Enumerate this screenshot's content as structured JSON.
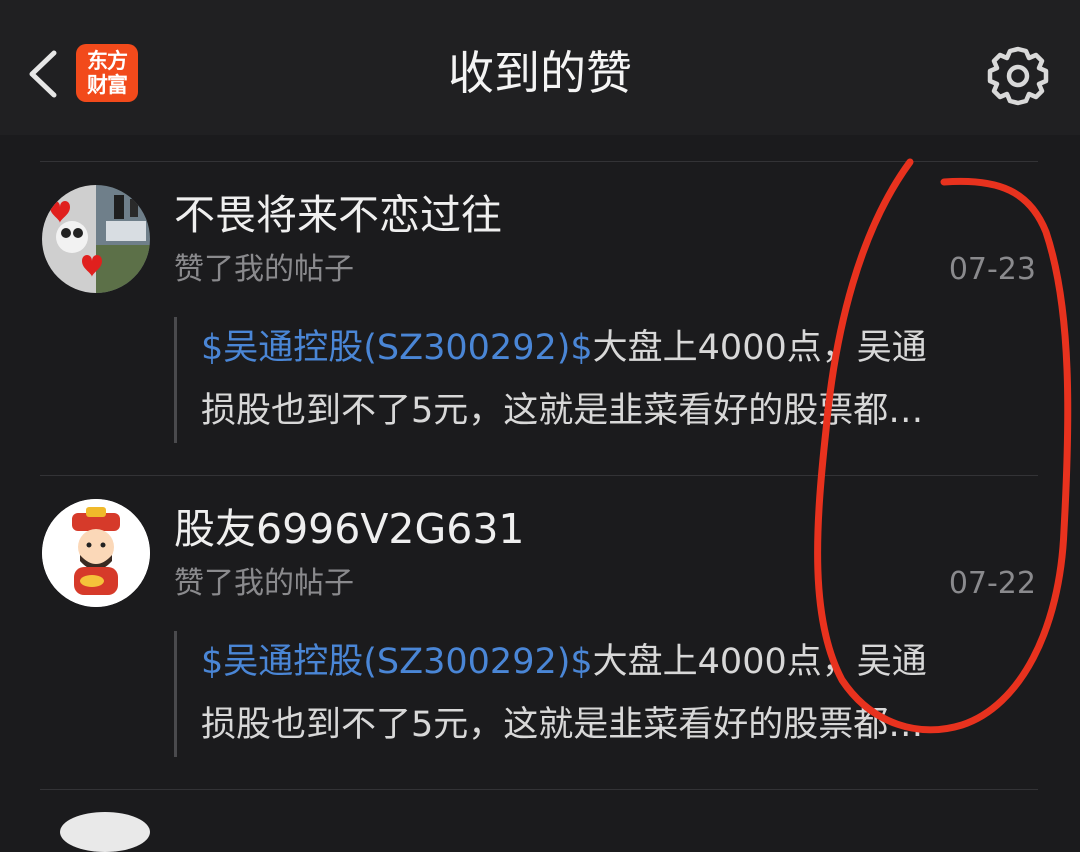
{
  "header": {
    "title": "收到的赞",
    "logo_line1": "东方",
    "logo_line2": "财富"
  },
  "colors": {
    "background": "#1b1b1d",
    "header": "#202022",
    "logo": "#f24a1b",
    "link": "#4a86d6",
    "annotation": "#e8321e"
  },
  "icons": [
    "back-arrow-icon",
    "gear-icon"
  ],
  "items": [
    {
      "user": "不畏将来不恋过往",
      "action": "赞了我的帖子",
      "date": "07-23",
      "stock": "$吴通控股(SZ300292)$",
      "line1_rest": "大盘上4000点，吴通",
      "line2": "损股也到不了5元，这就是韭菜看好的股票都…"
    },
    {
      "user": "股友6996V2G631",
      "action": "赞了我的帖子",
      "date": "07-22",
      "stock": "$吴通控股(SZ300292)$",
      "line1_rest": "大盘上4000点，吴通",
      "line2": "损股也到不了5元，这就是韭菜看好的股票都…"
    }
  ]
}
